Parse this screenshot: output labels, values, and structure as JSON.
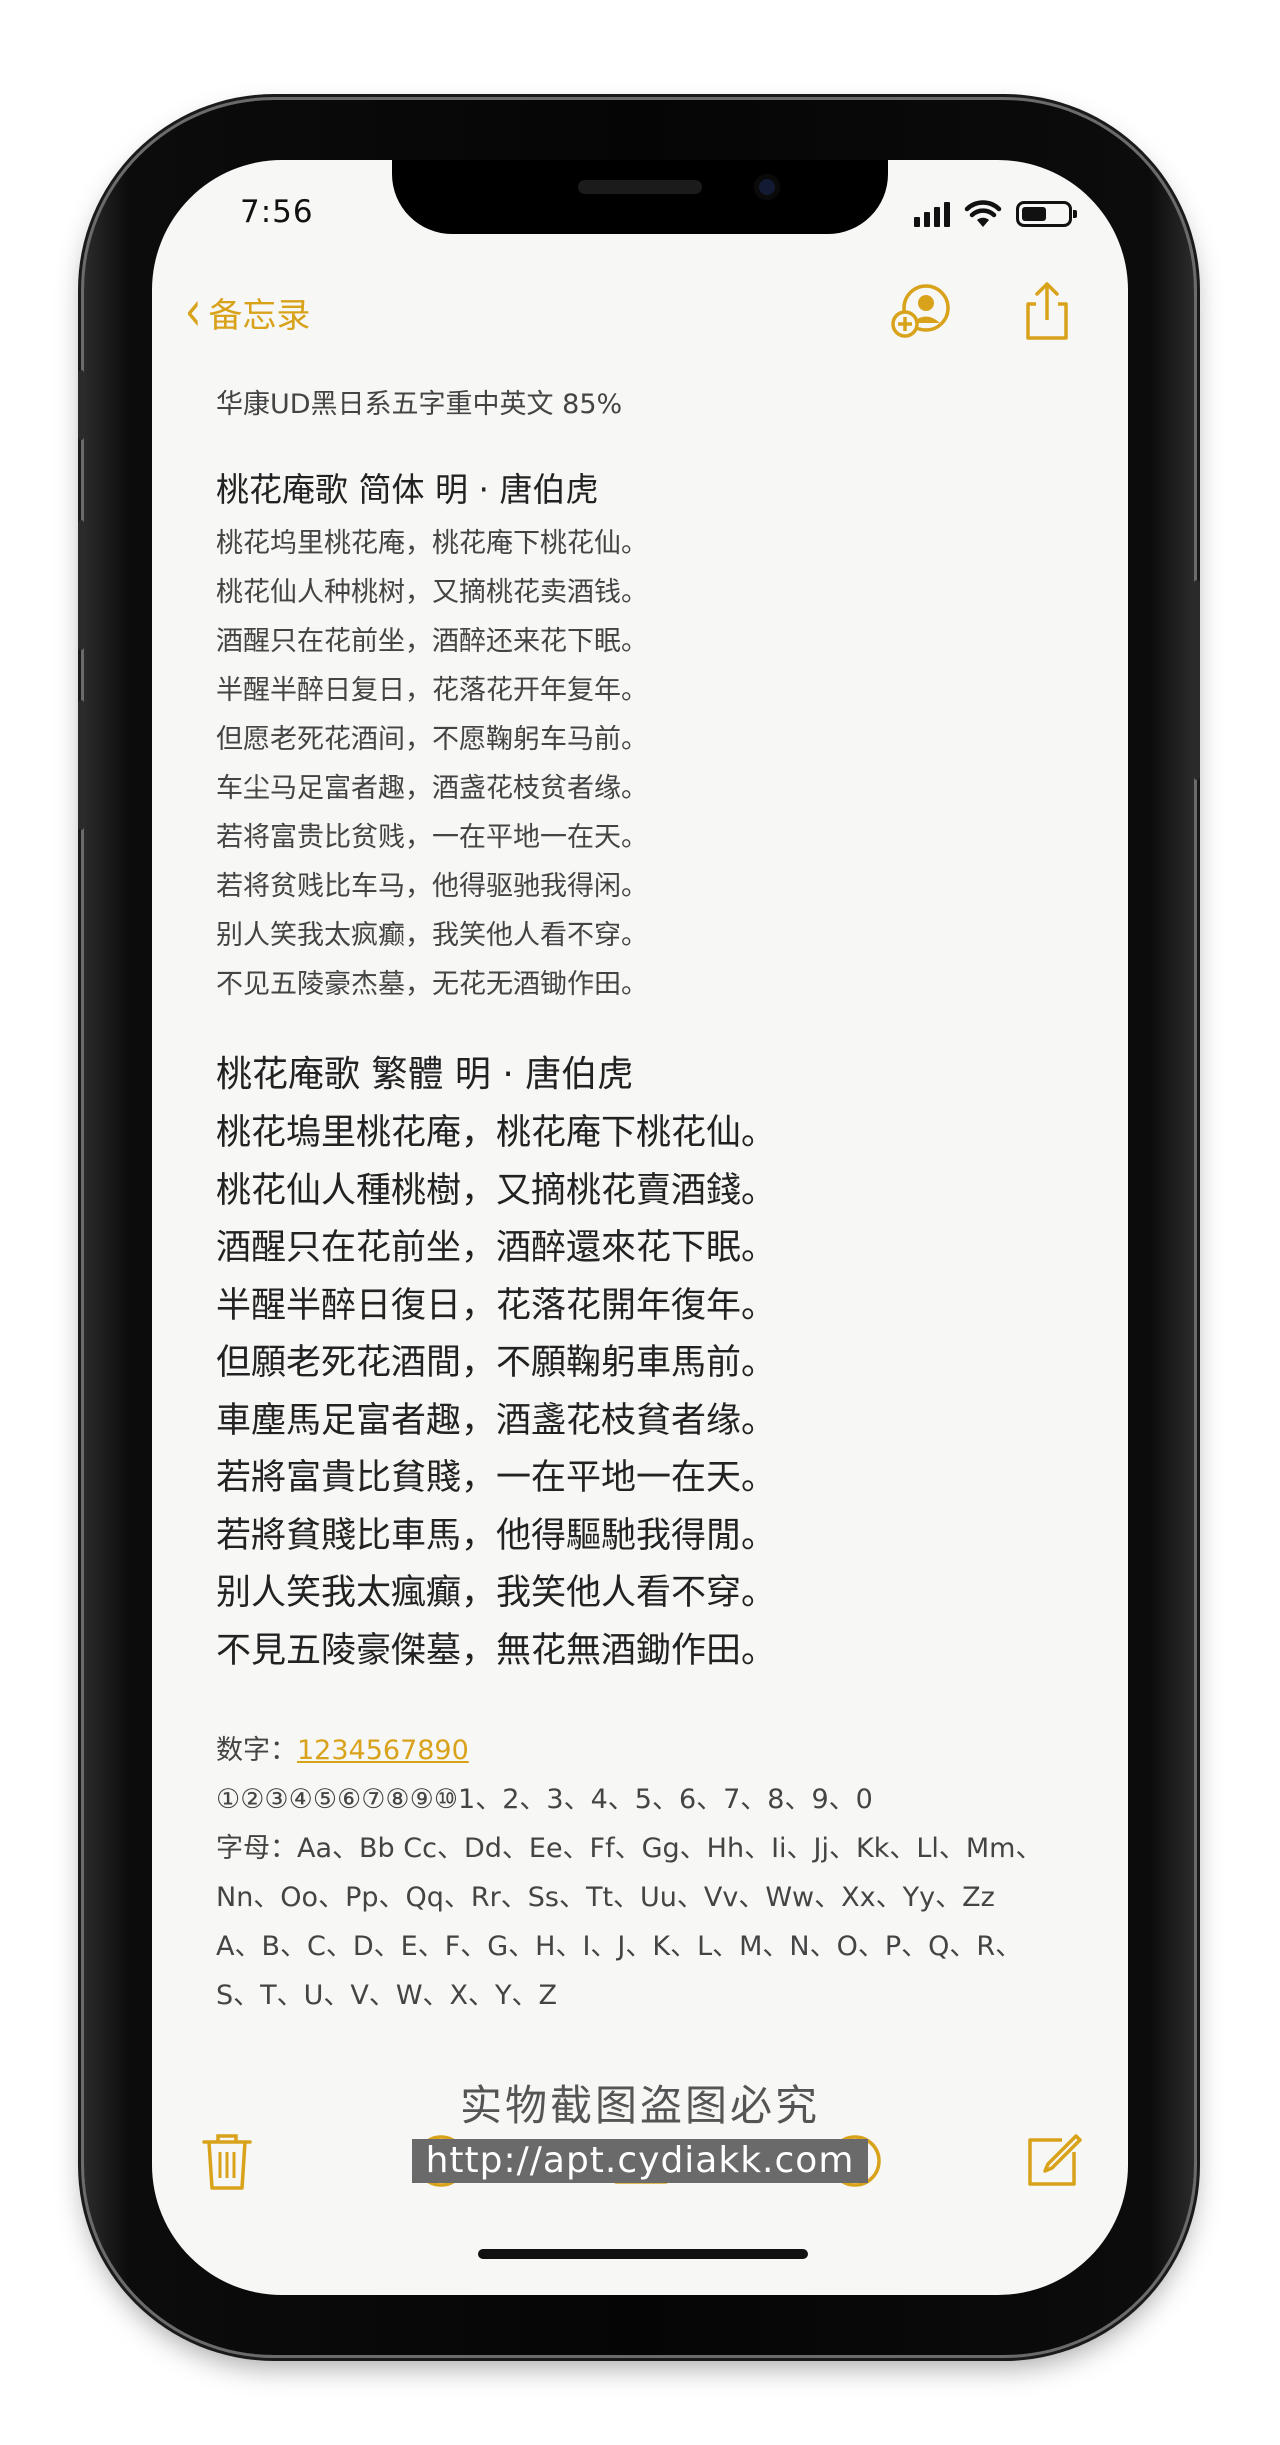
{
  "status": {
    "time": "7:56"
  },
  "nav": {
    "back_label": "备忘录"
  },
  "note": {
    "header": "华康UD黑日系五字重中英文 85%",
    "poem_simplified": {
      "title": "桃花庵歌 简体   明 · 唐伯虎",
      "lines": [
        "桃花坞里桃花庵，桃花庵下桃花仙。",
        "桃花仙人种桃树，又摘桃花卖酒钱。",
        "酒醒只在花前坐，酒醉还来花下眠。",
        "半醒半醉日复日，花落花开年复年。",
        "但愿老死花酒间，不愿鞠躬车马前。",
        "车尘马足富者趣，酒盏花枝贫者缘。",
        "若将富贵比贫贱，一在平地一在天。",
        "若将贫贱比车马，他得驱驰我得闲。",
        "别人笑我太疯癫，我笑他人看不穿。",
        "不见五陵豪杰墓，无花无酒锄作田。"
      ]
    },
    "poem_traditional": {
      "title": "桃花庵歌 繁體     明 · 唐伯虎",
      "lines": [
        "桃花塢里桃花庵，桃花庵下桃花仙。",
        "桃花仙人種桃樹，又摘桃花賣酒錢。",
        "酒醒只在花前坐，酒醉還來花下眠。",
        "半醒半醉日復日，花落花開年復年。",
        "但願老死花酒間，不願鞠躬車馬前。",
        "車塵馬足富者趣，酒盞花枝貧者缘。",
        "若將富貴比貧賤，一在平地一在天。",
        "若將貧賤比車馬，他得驅馳我得閒。",
        "别人笑我太瘋癲，我笑他人看不穿。",
        "不見五陵豪傑墓，無花無酒鋤作田。"
      ]
    },
    "numbers_label": "数字：",
    "numbers_link": "1234567890",
    "numbers_line": "①②③④⑤⑥⑦⑧⑨⑩1、2、3、4、5、6、7、8、9、0",
    "letters_line1": "字母：Aa、Bb Cc、Dd、Ee、Ff、Gg、Hh、Ii、Jj、Kk、Ll、Mm、",
    "letters_line2": "Nn、Oo、Pp、Qq、Rr、Ss、Tt、Uu、Vv、Ww、Xx、Yy、Zz",
    "letters_line3": "A、B、C、D、E、F、G、H、I、J、K、L、M、N、O、P、Q、R、",
    "letters_line4": "S、T、U、V、W、X、Y、Z"
  },
  "watermark": {
    "line1": "实物截图盗图必究",
    "line2": "http://apt.cydiakk.com"
  },
  "colors": {
    "accent": "#d9a21b",
    "paper": "#f7f7f5"
  }
}
